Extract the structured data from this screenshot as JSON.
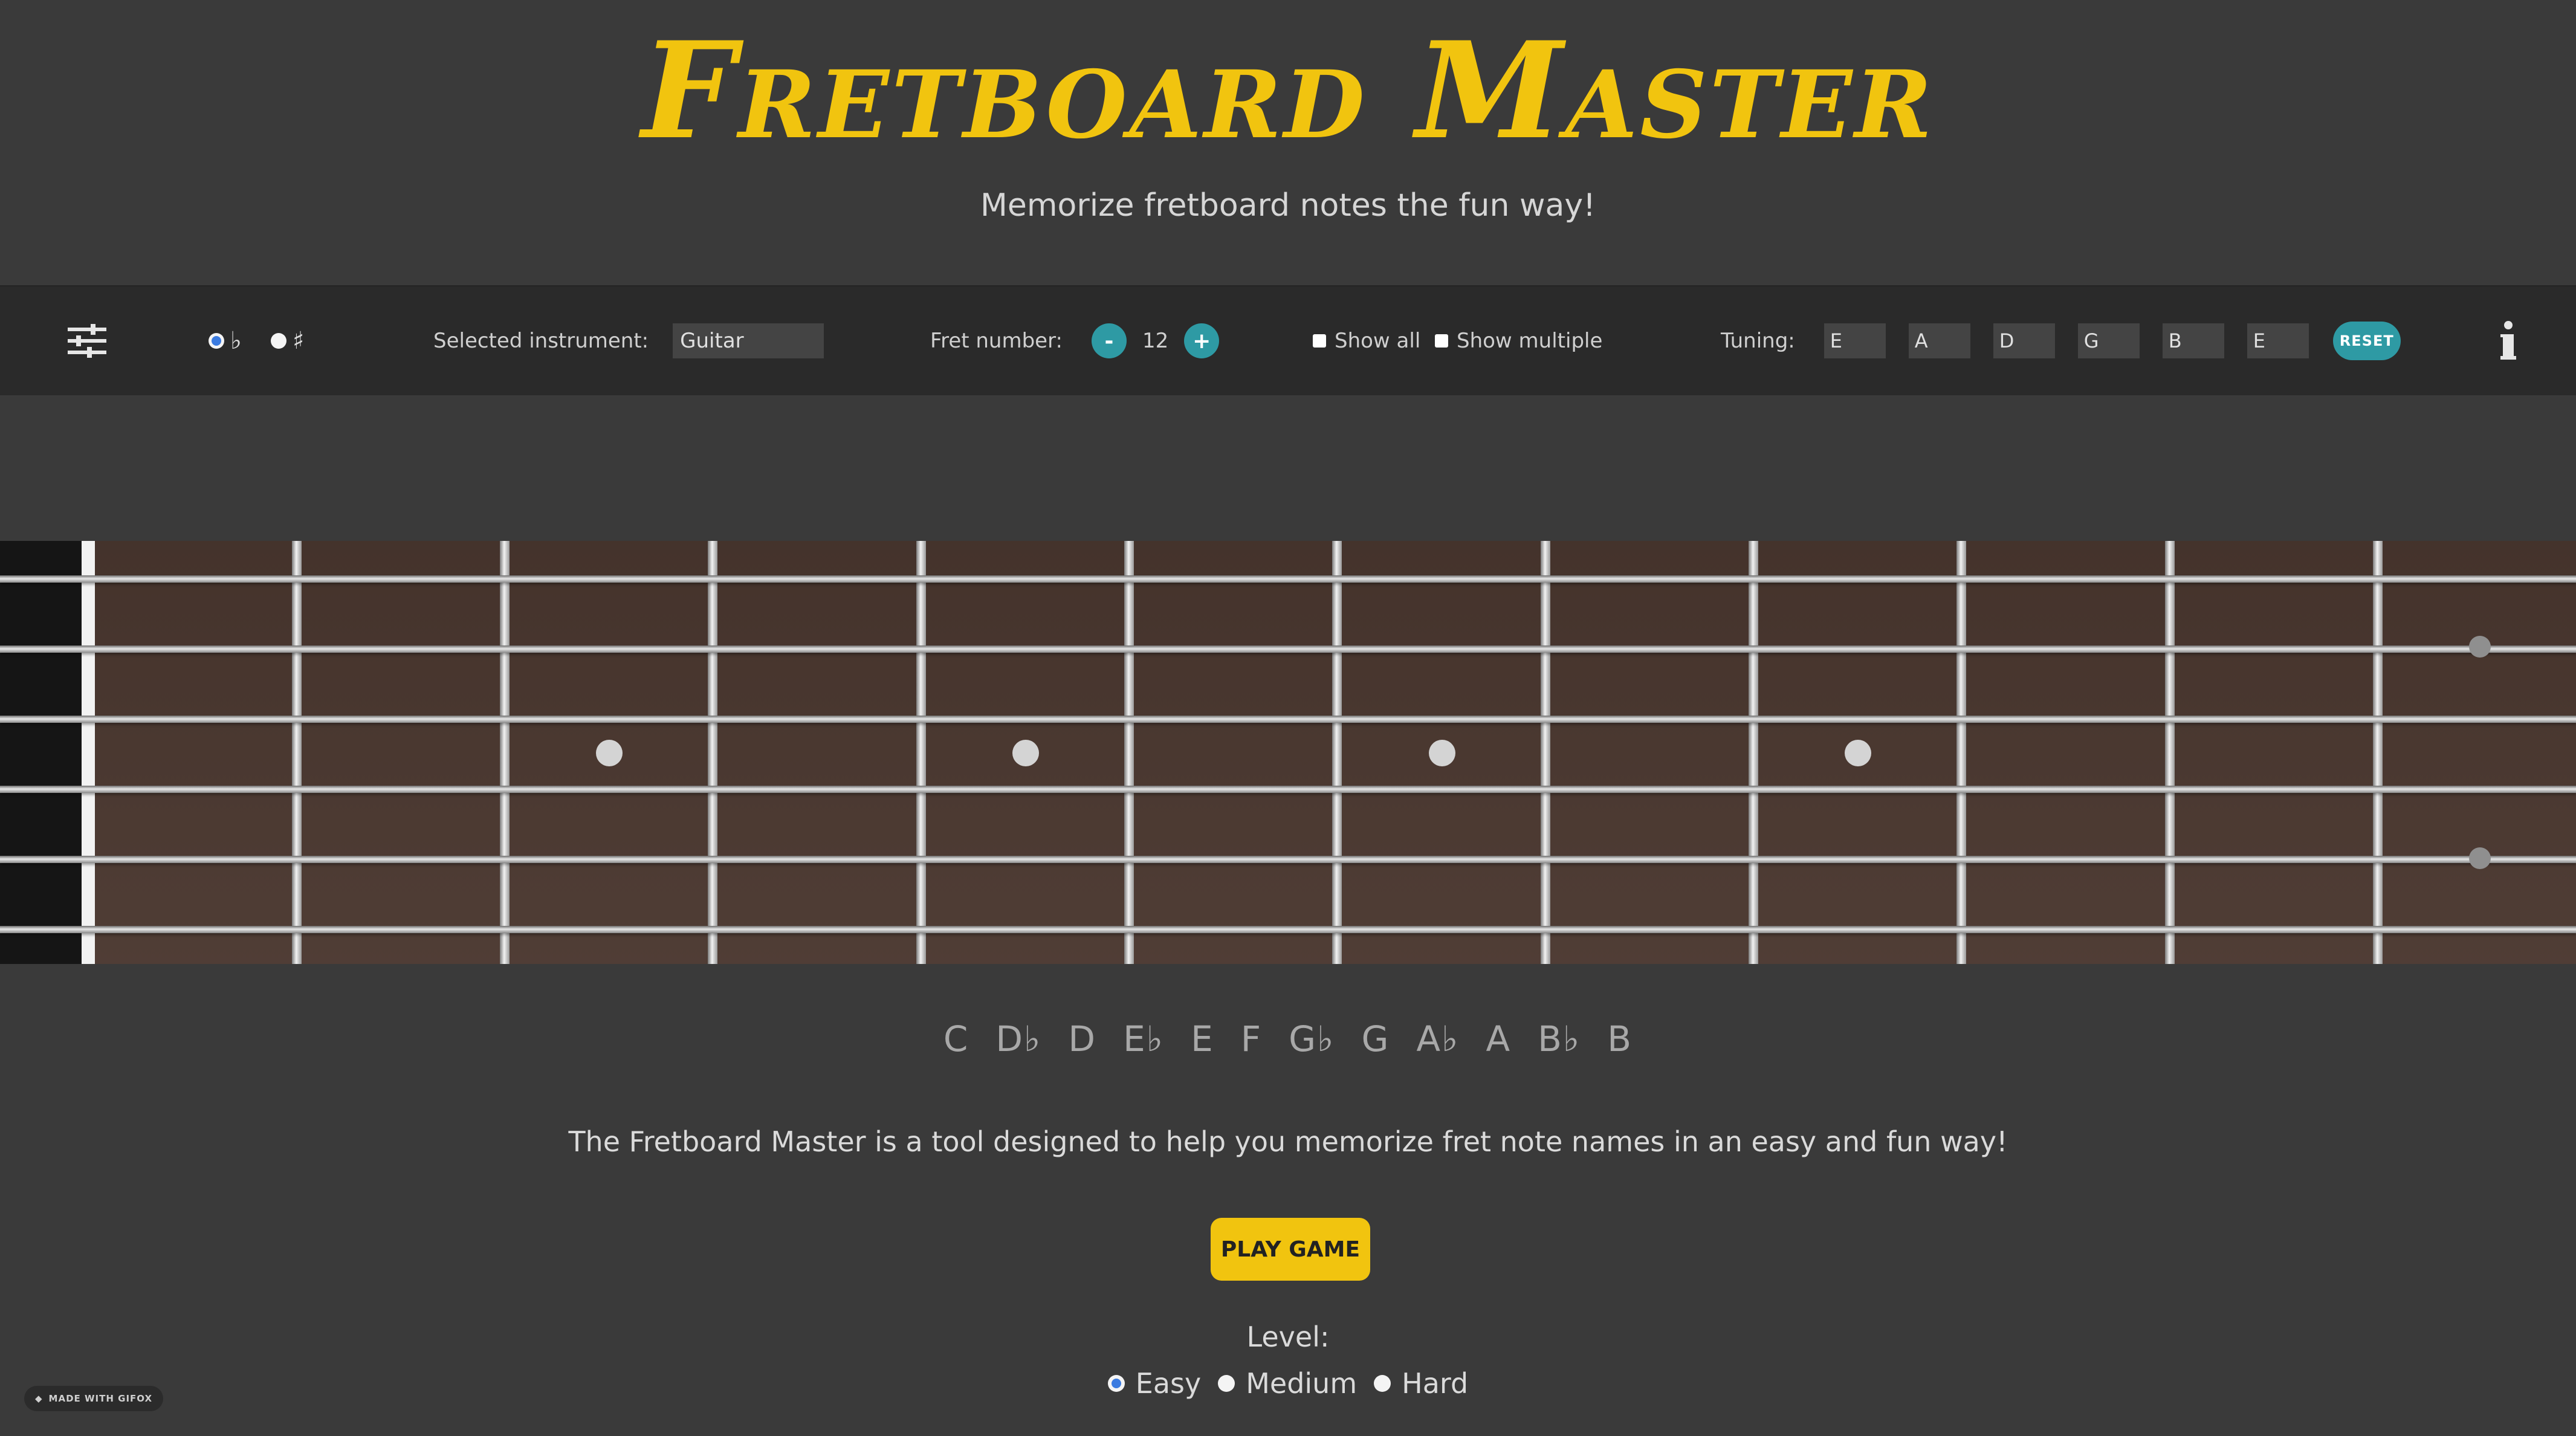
{
  "header": {
    "title": "Fretboard Master",
    "subtitle": "Memorize fretboard notes the fun way!"
  },
  "toolbar": {
    "menu_icon": "sliders-icon",
    "accidentals": [
      {
        "symbol": "♭",
        "selected": true
      },
      {
        "symbol": "♯",
        "selected": false
      }
    ],
    "instrument_label": "Selected instrument:",
    "instrument_value": "Guitar",
    "fret_label": "Fret number:",
    "fret_minus": "-",
    "fret_value": "12",
    "fret_plus": "+",
    "show_all": "Show all",
    "show_multiple": "Show multiple",
    "tuning_label": "Tuning:",
    "tuning": [
      "E",
      "A",
      "D",
      "G",
      "B",
      "E"
    ],
    "reset": "RESET",
    "info_icon": "info-icon"
  },
  "notes": [
    "C",
    "D♭",
    "D",
    "E♭",
    "E",
    "F",
    "G♭",
    "G",
    "A♭",
    "A",
    "B♭",
    "B"
  ],
  "description": "The Fretboard Master is a tool designed to help you memorize fret note names in an easy and fun way!",
  "play_button": "PLAY GAME",
  "level": {
    "label": "Level:",
    "options": [
      {
        "label": "Easy",
        "selected": true
      },
      {
        "label": "Medium",
        "selected": false
      },
      {
        "label": "Hard",
        "selected": false
      }
    ]
  },
  "watermark": "MADE WITH GIFOX",
  "colors": {
    "accent_yellow": "#f1c40f",
    "accent_teal": "#2e9aa4",
    "radio_blue": "#3b7be0",
    "fretboard": "#4a372f"
  }
}
